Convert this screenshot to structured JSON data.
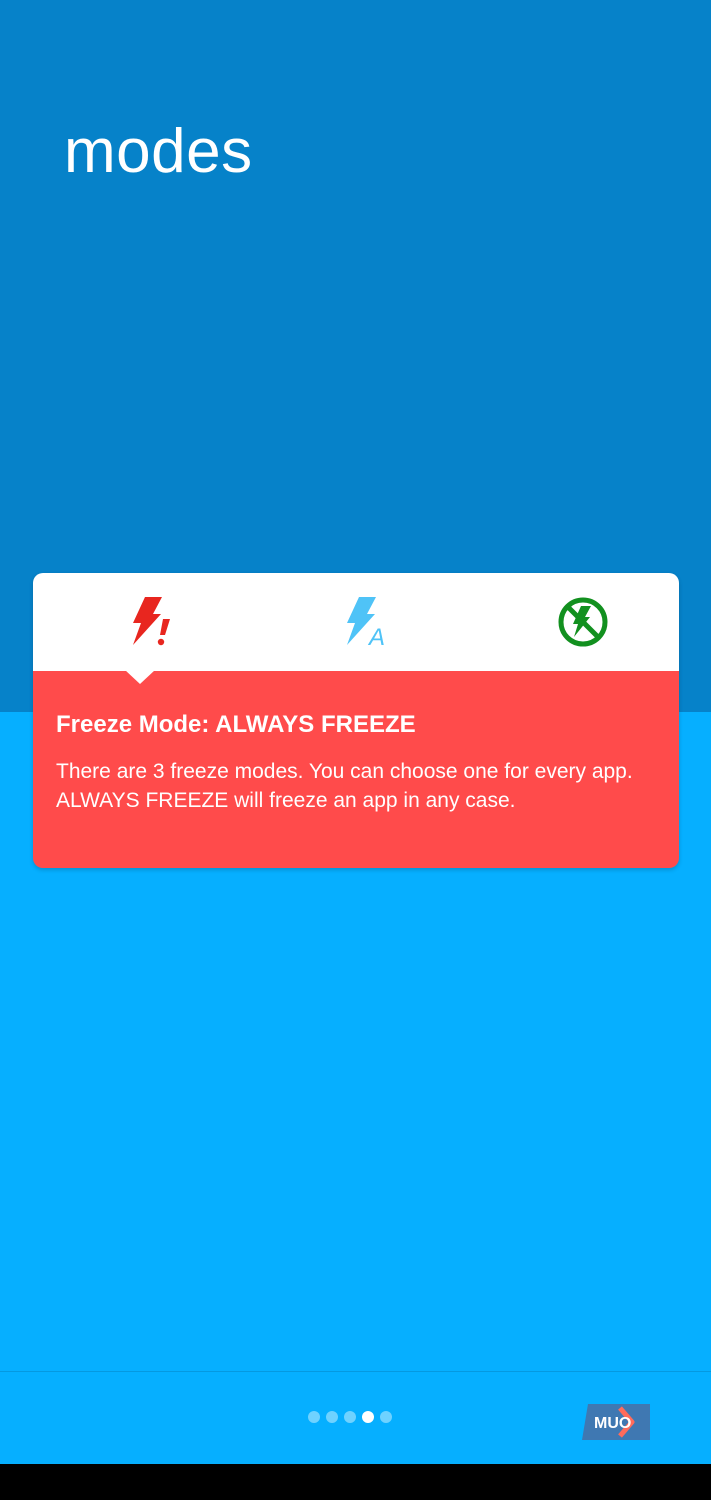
{
  "header": {
    "title": "modes"
  },
  "card": {
    "tabs": [
      {
        "name": "always-freeze",
        "icon": "bolt-exclamation-icon",
        "color": "#e8261f"
      },
      {
        "name": "auto-freeze",
        "icon": "bolt-a-icon",
        "color": "#4fc3f7"
      },
      {
        "name": "never-freeze",
        "icon": "bolt-crossed-circle-icon",
        "color": "#12901f"
      }
    ],
    "selected_tab": 0,
    "mode_title": "Freeze Mode: ALWAYS FREEZE",
    "mode_description": "There are 3 freeze modes. You can choose one for every app. ALWAYS FREEZE will freeze an app in any case.",
    "accent_color": "#ff4b4b"
  },
  "footer": {
    "pages_total": 5,
    "current_page": 4,
    "next_icon": "next-arrow-icon",
    "watermark": "MUO"
  },
  "colors": {
    "top_band": "#0682c9",
    "background": "#06afff"
  }
}
